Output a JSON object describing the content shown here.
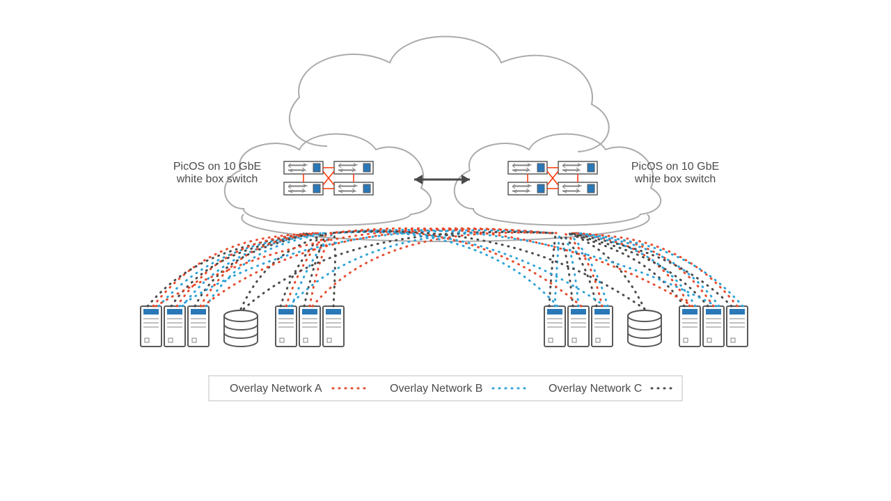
{
  "labels": {
    "left_switch_l1": "PicOS on 10 GbE",
    "left_switch_l2": "white box switch",
    "right_switch_l1": "PicOS on 10 GbE",
    "right_switch_l2": "white box switch"
  },
  "legend": {
    "a": "Overlay Network A",
    "b": "Overlay Network B",
    "c": "Overlay Network C"
  },
  "colors": {
    "overlay_a": "#e64b2e",
    "overlay_b": "#2fa3d8",
    "overlay_c": "#4a4a4a",
    "accent_blue": "#2a78b8",
    "switch_cross": "#ff3300",
    "outline": "#595959",
    "cloud": "#aaaaaa"
  },
  "diagram": {
    "overlay_a_members": [
      "srv1",
      "srv2",
      "srv3",
      "srv4",
      "srv5",
      "srv9",
      "srv10",
      "srv11",
      "srv12"
    ],
    "overlay_b_members": [
      "srv1",
      "srv2",
      "srv3",
      "srv4",
      "srv7",
      "srv8",
      "srv9",
      "srv10",
      "srv11",
      "srv12"
    ],
    "overlay_c_members": [
      "srv1",
      "srv2",
      "srv3",
      "db1",
      "srv4",
      "srv5",
      "srv6",
      "srv7",
      "srv8",
      "srv9",
      "db2",
      "srv10",
      "srv11",
      "srv12"
    ]
  }
}
